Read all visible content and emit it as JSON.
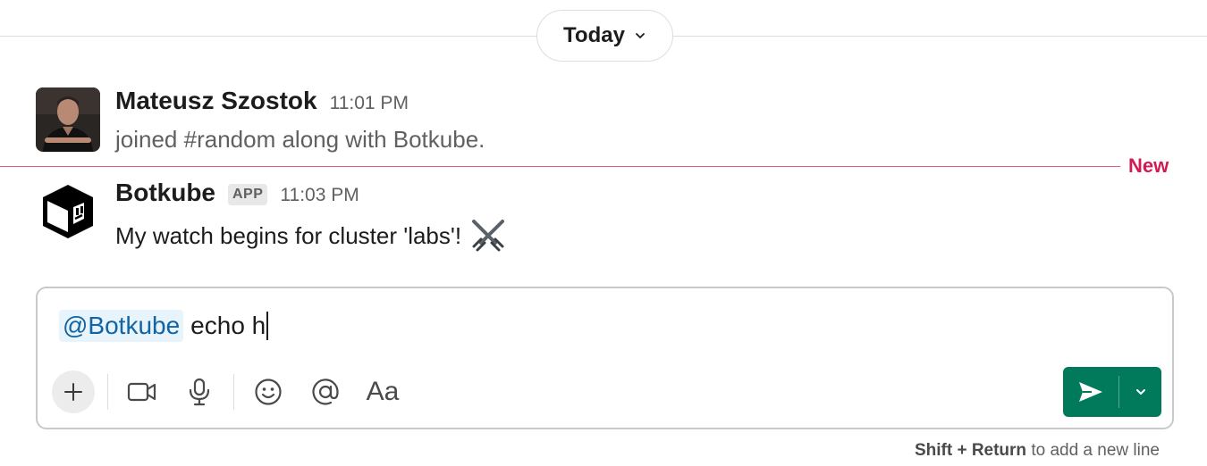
{
  "date_divider": {
    "label": "Today"
  },
  "messages": [
    {
      "author": "Mateusz Szostok",
      "time": "11:01 PM",
      "text": "joined #random along with Botkube."
    },
    {
      "author": "Botkube",
      "badge": "APP",
      "time": "11:03 PM",
      "text": "My watch begins for cluster 'labs'!",
      "emoji": "crossed-swords"
    }
  ],
  "new_divider": {
    "label": "New"
  },
  "composer": {
    "mention": "@Botkube",
    "text": "echo h",
    "toolbar_icons": [
      "plus-icon",
      "video-icon",
      "microphone-icon",
      "emoji-icon",
      "mention-icon",
      "formatting-icon"
    ],
    "formatting_label": "Aa"
  },
  "hint": {
    "keys": "Shift + Return",
    "text": " to add a new line"
  },
  "colors": {
    "new_divider": "#e01e5a",
    "send_button": "#007a5a",
    "mention_text": "#1264a3",
    "mention_bg": "#e8f4fb"
  }
}
